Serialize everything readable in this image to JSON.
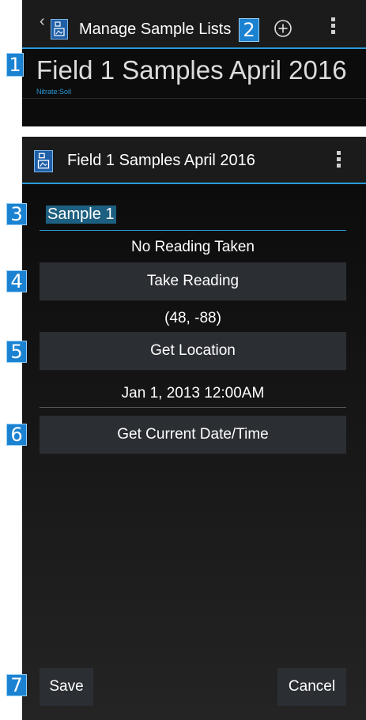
{
  "top_panel": {
    "actionbar": {
      "title": "Manage Sample Lists",
      "back_icon": "chevron-left-icon",
      "app_icon": "app-icon",
      "add_icon": "plus-circle-icon",
      "overflow_icon": "overflow-menu-icon"
    },
    "list_item": {
      "title": "Field 1 Samples April 2016",
      "subtitle": "Nitrate:Soil"
    }
  },
  "bottom_panel": {
    "actionbar": {
      "title": "Field 1 Samples April 2016",
      "app_icon": "app-icon",
      "overflow_icon": "overflow-menu-icon"
    },
    "form": {
      "sample_name": "Sample 1",
      "reading_status": "No Reading Taken",
      "take_reading_label": "Take Reading",
      "location_value": "(48, -88)",
      "get_location_label": "Get Location",
      "datetime_value": "Jan 1, 2013 12:00AM",
      "get_datetime_label": "Get Current Date/Time"
    },
    "footer": {
      "save_label": "Save",
      "cancel_label": "Cancel"
    }
  },
  "callouts": [
    "1",
    "2",
    "3",
    "4",
    "5",
    "6",
    "7"
  ],
  "colors": {
    "accent": "#2a9ad8",
    "callout_bg": "#1b82d2",
    "button_bg": "#2b2e33",
    "panel_bg": "#0c0c0c"
  }
}
